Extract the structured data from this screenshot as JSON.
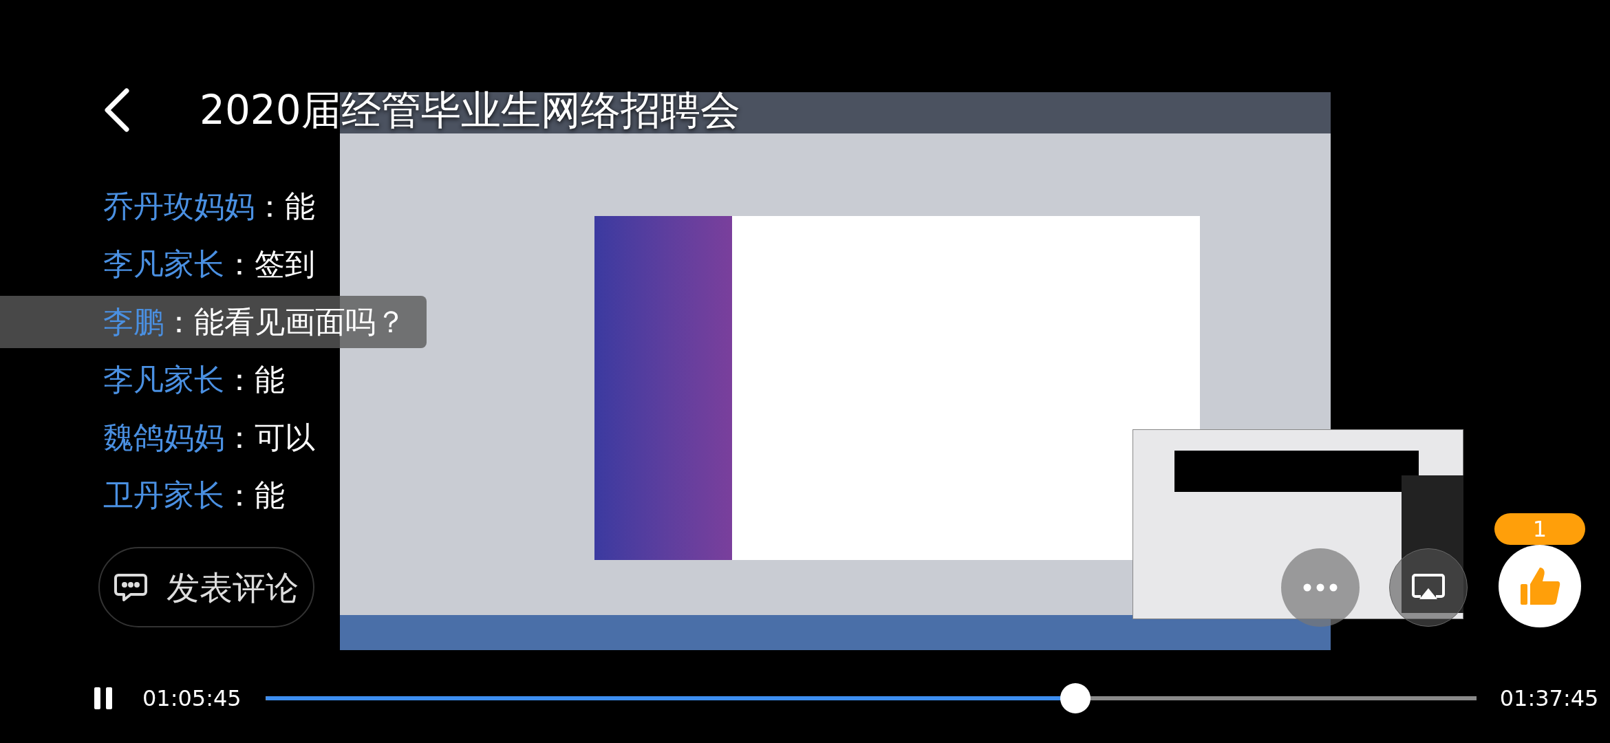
{
  "header": {
    "title": "2020届经管毕业生网络招聘会"
  },
  "comments": [
    {
      "author": "乔丹玫妈妈",
      "separator": "：",
      "text": "能",
      "highlighted": false
    },
    {
      "author": "李凡家长",
      "separator": "：",
      "text": "签到",
      "highlighted": false
    },
    {
      "author": "李鹏",
      "separator": "：",
      "text": "能看见画面吗？",
      "highlighted": true
    },
    {
      "author": "李凡家长",
      "separator": "：",
      "text": "能",
      "highlighted": false
    },
    {
      "author": "魏鸽妈妈",
      "separator": "：",
      "text": "可以",
      "highlighted": false
    },
    {
      "author": "卫丹家长",
      "separator": "：",
      "text": "能",
      "highlighted": false
    }
  ],
  "comment_button": {
    "label": "发表评论"
  },
  "like": {
    "count": "1"
  },
  "player": {
    "playing": true,
    "elapsed": "01:05:45",
    "duration": "01:37:45",
    "level": 0.669
  }
}
